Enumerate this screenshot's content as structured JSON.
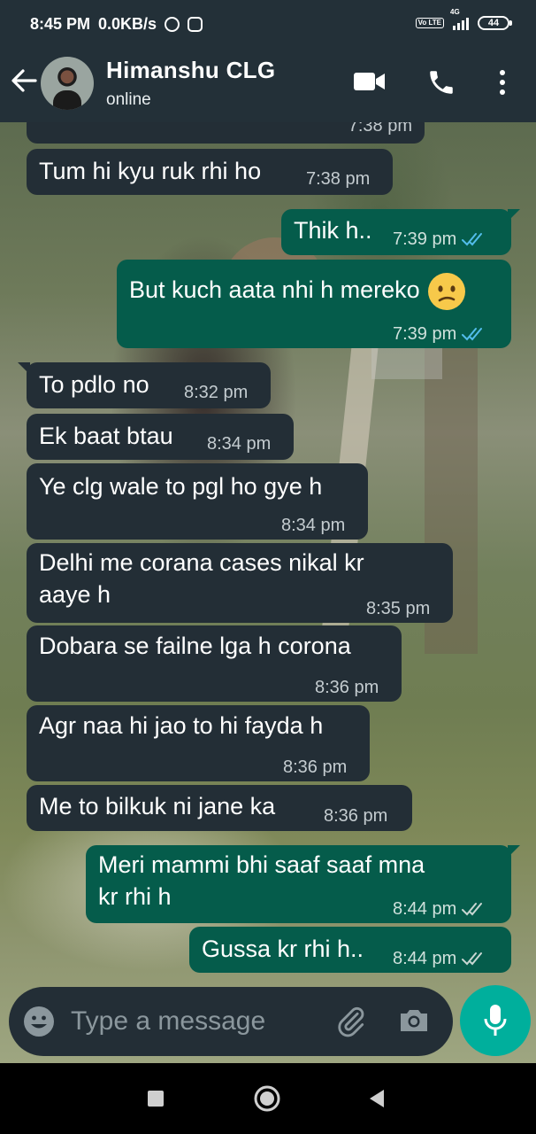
{
  "status_bar": {
    "time": "8:45 PM",
    "speed": "0.0KB/s",
    "volte": "Vo LTE",
    "network": "4G",
    "battery": "44"
  },
  "header": {
    "back_icon": "arrow-left-icon",
    "contact_name": "Himanshu CLG",
    "contact_status": "online",
    "video_icon": "video-call-icon",
    "call_icon": "phone-icon",
    "menu_icon": "more-vertical-icon"
  },
  "messages": [
    {
      "dir": "in",
      "text": "",
      "time": "7:38 pm"
    },
    {
      "dir": "in",
      "text": "Tum hi kyu ruk rhi ho",
      "time": "7:38 pm"
    },
    {
      "dir": "out",
      "text": "Thik h..",
      "time": "7:39 pm",
      "ticks": "read"
    },
    {
      "dir": "out",
      "text": "But kuch aata nhi h mereko",
      "emoji": "confused-face",
      "time": "7:39 pm",
      "ticks": "read"
    },
    {
      "dir": "in",
      "text": "To pdlo no",
      "time": "8:32 pm"
    },
    {
      "dir": "in",
      "text": "Ek baat btau",
      "time": "8:34 pm"
    },
    {
      "dir": "in",
      "text": "Ye clg wale to pgl ho gye h",
      "time": "8:34 pm"
    },
    {
      "dir": "in",
      "text": "Delhi me corana cases nikal kr",
      "text2": "aaye h",
      "time": "8:35 pm"
    },
    {
      "dir": "in",
      "text": "Dobara se failne lga h corona",
      "time": "8:36 pm"
    },
    {
      "dir": "in",
      "text": "Agr naa hi jao to hi fayda h",
      "time": "8:36 pm"
    },
    {
      "dir": "in",
      "text": "Me to bilkuk ni jane ka",
      "time": "8:36 pm"
    },
    {
      "dir": "out",
      "text": "Meri mammi bhi saaf saaf mna",
      "text2": "kr rhi h",
      "time": "8:44 pm",
      "ticks": "delivered"
    },
    {
      "dir": "out",
      "text": "Gussa kr rhi h..",
      "time": "8:44 pm",
      "ticks": "delivered"
    }
  ],
  "composer": {
    "placeholder": "Type a message",
    "emoji_icon": "emoji-icon",
    "attach_icon": "paperclip-icon",
    "camera_icon": "camera-icon",
    "mic_icon": "microphone-icon"
  },
  "nav": {
    "recents_icon": "square-recents-icon",
    "home_icon": "circle-home-icon",
    "back_icon": "triangle-back-icon"
  },
  "colors": {
    "header_bg": "#233038",
    "incoming_bubble": "#232e36",
    "outgoing_bubble": "#055c4b",
    "read_tick": "#53bdeb",
    "accent": "#00af9c"
  }
}
